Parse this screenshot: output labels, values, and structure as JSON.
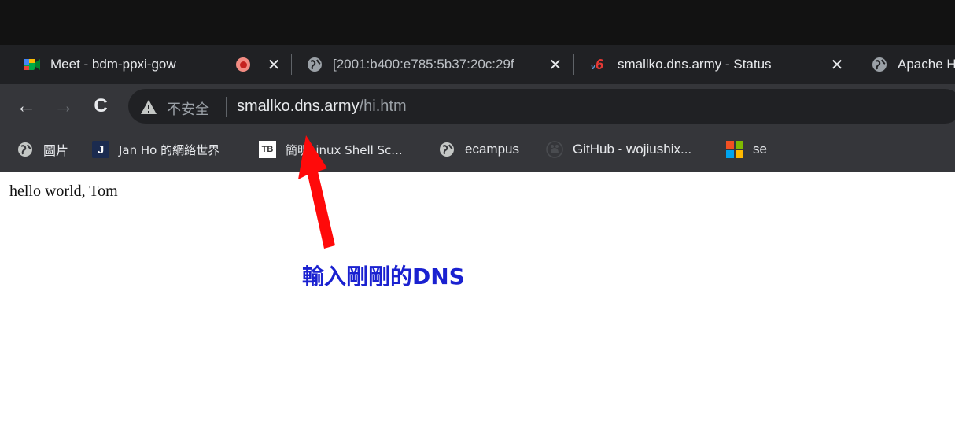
{
  "browser": {
    "tabs": [
      {
        "label": "Meet - bdm-ppxi-gow",
        "icon": "google-meet-icon"
      },
      {
        "label": "[2001:b400:e785:5b37:20c:29f",
        "icon": "globe-icon"
      },
      {
        "label": "smallko.dns.army - Status",
        "icon": "v6-icon"
      },
      {
        "label": "Apache H",
        "icon": "globe-icon"
      }
    ],
    "v6_icon_text": "v6",
    "close_glyph": "✕",
    "back_glyph": "←",
    "forward_glyph": "→",
    "reload_glyph": "C",
    "security_label": "不安全",
    "url_host": "smallko.dns.army",
    "url_path": "/hi.htm",
    "bookmarks": [
      {
        "label": "圖片",
        "icon": "globe-icon"
      },
      {
        "label": "Jan Ho 的網絡世界",
        "icon": "j-icon",
        "icon_text": "J"
      },
      {
        "label": "簡明Linux Shell Sc...",
        "icon": "tb-icon",
        "icon_text": "TB"
      },
      {
        "label": "ecampus",
        "icon": "globe-icon"
      },
      {
        "label": "GitHub - wojiushix...",
        "icon": "github-icon"
      },
      {
        "label": "se",
        "icon": "microsoft-icon"
      }
    ]
  },
  "page": {
    "body_text": "hello world, Tom"
  },
  "annotation": {
    "text": "輸入剛剛的DNS",
    "color": "#1a21d0",
    "arrow_color": "#ff0a0a"
  },
  "colors": {
    "titlebar": "#121212",
    "tabstrip": "#202124",
    "toolbar": "#35363a",
    "recording": "#f28b82"
  }
}
